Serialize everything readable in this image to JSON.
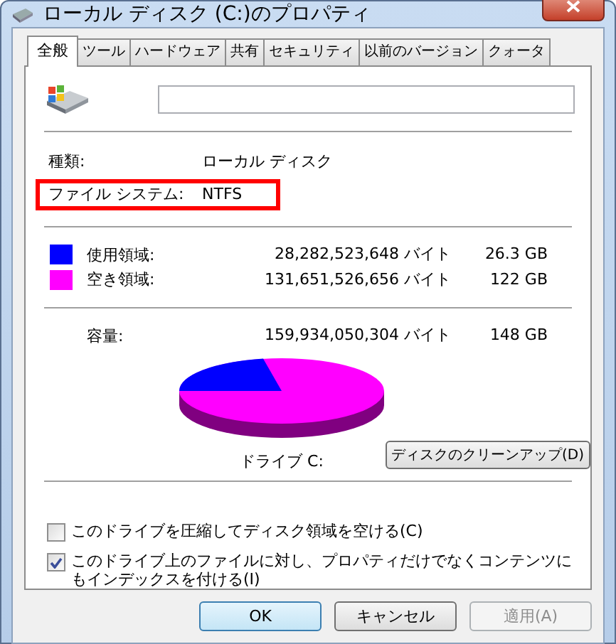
{
  "window": {
    "title": "ローカル ディスク (C:)のプロパティ"
  },
  "tabs": [
    {
      "label": "全般",
      "selected": true
    },
    {
      "label": "ツール",
      "selected": false
    },
    {
      "label": "ハードウェア",
      "selected": false
    },
    {
      "label": "共有",
      "selected": false
    },
    {
      "label": "セキュリティ",
      "selected": false
    },
    {
      "label": "以前のバージョン",
      "selected": false
    },
    {
      "label": "クォータ",
      "selected": false
    }
  ],
  "info": [
    {
      "label": "種類:",
      "value": "ローカル ディスク",
      "highlighted": false
    },
    {
      "label": "ファイル システム:",
      "value": "NTFS",
      "highlighted": true
    }
  ],
  "usage": [
    {
      "label": "使用領域:",
      "bytes": "28,282,523,648 バイト",
      "size": "26.3 GB",
      "color": "#0000ff"
    },
    {
      "label": "空き領域:",
      "bytes": "131,651,526,656 バイト",
      "size": "122 GB",
      "color": "#ff00ff"
    }
  ],
  "capacity": {
    "label": "容量:",
    "bytes": "159,934,050,304 バイト",
    "size": "148 GB"
  },
  "drive_label": "ドライブ C:",
  "cleanup_button": "ディスクのクリーンアップ(D)",
  "options": [
    {
      "label": "このドライブを圧縮してディスク領域を空ける(C)",
      "checked": false
    },
    {
      "label": "このドライブ上のファイルに対し、プロパティだけでなくコンテンツにもインデックスを付ける(I)",
      "checked": true
    }
  ],
  "buttons": [
    {
      "label": "OK",
      "default": true,
      "disabled": false
    },
    {
      "label": "キャンセル",
      "default": false,
      "disabled": false
    },
    {
      "label": "適用(A)",
      "default": false,
      "disabled": true
    }
  ]
}
